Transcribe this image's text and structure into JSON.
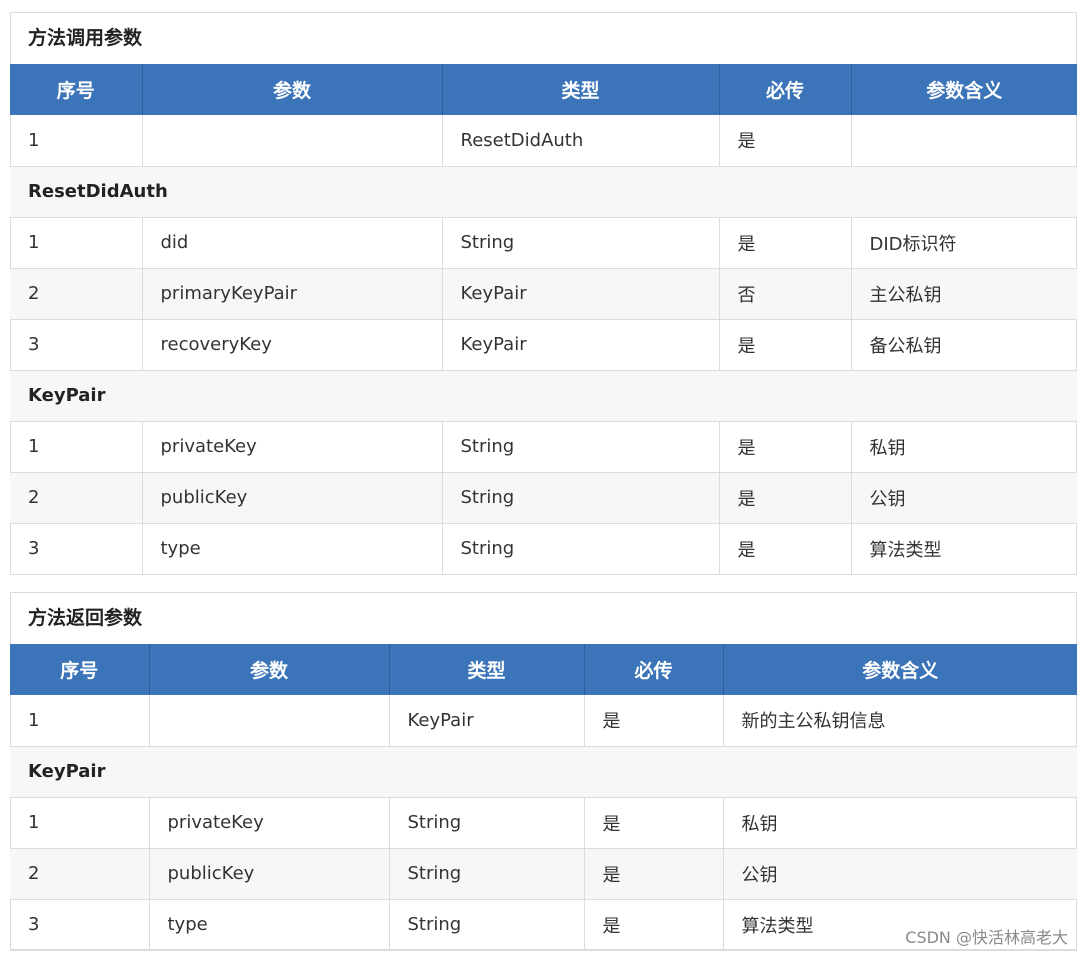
{
  "call_params": {
    "title": "方法调用参数",
    "headers": [
      "序号",
      "参数",
      "类型",
      "必传",
      "参数含义"
    ],
    "row0": {
      "no": "1",
      "param": "",
      "type": "ResetDidAuth",
      "required": "是",
      "meaning": ""
    },
    "section1": "ResetDidAuth",
    "s1_rows": [
      {
        "no": "1",
        "param": "did",
        "type": "String",
        "required": "是",
        "meaning": "DID标识符"
      },
      {
        "no": "2",
        "param": "primaryKeyPair",
        "type": "KeyPair",
        "required": "否",
        "meaning": "主公私钥"
      },
      {
        "no": "3",
        "param": "recoveryKey",
        "type": "KeyPair",
        "required": "是",
        "meaning": "备公私钥"
      }
    ],
    "section2": "KeyPair",
    "s2_rows": [
      {
        "no": "1",
        "param": "privateKey",
        "type": "String",
        "required": "是",
        "meaning": "私钥"
      },
      {
        "no": "2",
        "param": "publicKey",
        "type": "String",
        "required": "是",
        "meaning": "公钥"
      },
      {
        "no": "3",
        "param": "type",
        "type": "String",
        "required": "是",
        "meaning": "算法类型"
      }
    ]
  },
  "return_params": {
    "title": "方法返回参数",
    "headers": [
      "序号",
      "参数",
      "类型",
      "必传",
      "参数含义"
    ],
    "row0": {
      "no": "1",
      "param": "",
      "type": "KeyPair",
      "required": "是",
      "meaning": "新的主公私钥信息"
    },
    "section1": "KeyPair",
    "s1_rows": [
      {
        "no": "1",
        "param": "privateKey",
        "type": "String",
        "required": "是",
        "meaning": "私钥"
      },
      {
        "no": "2",
        "param": "publicKey",
        "type": "String",
        "required": "是",
        "meaning": "公钥"
      },
      {
        "no": "3",
        "param": "type",
        "type": "String",
        "required": "是",
        "meaning": "算法类型"
      }
    ]
  },
  "watermark": "CSDN @快活林高老大"
}
